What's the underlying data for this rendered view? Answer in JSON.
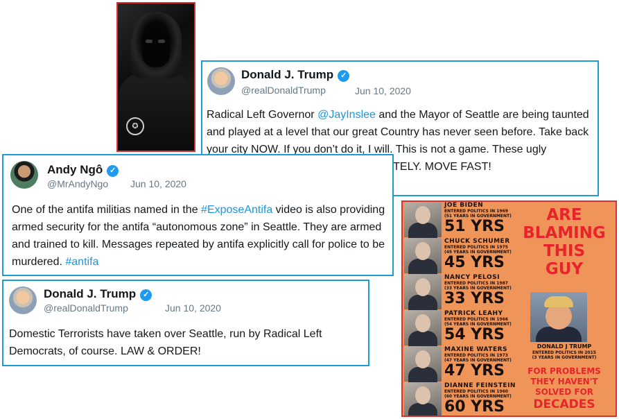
{
  "tweets": {
    "trump_1": {
      "name": "Donald J. Trump",
      "handle": "@realDonaldTrump",
      "date": "Jun 10, 2020",
      "text_before": "Radical Left Governor ",
      "mention": "@JayInslee",
      "text_after": " and the Mayor of Seattle are being taunted and played at a level that our great Country has never seen before. Take back your city NOW. If you don’t do it, I will. This is not a game. These ugly Anarchists must be stooped IMMEDIATELY. MOVE FAST!"
    },
    "ngo": {
      "name": "Andy Ngô",
      "handle": "@MrAndyNgo",
      "date": "Jun 10, 2020",
      "text_before": "One of the antifa militias named in the ",
      "hashtag1": "#ExposeAntifa",
      "text_middle": " video is also providing armed security for the antifa “autonomous zone” in Seattle. They are armed and trained to kill. Messages repeated by antifa explicitly call for police to be murdered. ",
      "hashtag2": "#antifa"
    },
    "trump_2": {
      "name": "Donald J. Trump",
      "handle": "@realDonaldTrump",
      "date": "Jun 10, 2020",
      "text": "Domestic Terrorists have taken over Seattle, run by Radical Left Democrats, of course. LAW & ORDER!"
    }
  },
  "meme": {
    "headline": [
      "ARE",
      "BLAMING",
      "THIS",
      "GUY"
    ],
    "politicians": [
      {
        "name": "JOE BIDEN",
        "detail1": "ENTERED POLITICS IN 1969",
        "detail2": "(51 YEARS IN GOVERNMENT)",
        "years": "51 YRS"
      },
      {
        "name": "CHUCK SCHUMER",
        "detail1": "ENTERED POLITICS IN 1975",
        "detail2": "(45 YEARS IN GOVERNMENT)",
        "years": "45 YRS"
      },
      {
        "name": "NANCY PELOSI",
        "detail1": "ENTERED POLITICS IN 1987",
        "detail2": "(33 YEARS IN GOVERNMENT)",
        "years": "33 YRS"
      },
      {
        "name": "PATRICK LEAHY",
        "detail1": "ENTERED POLITICS IN 1966",
        "detail2": "(54 YEARS IN GOVERNMENT)",
        "years": "54 YRS"
      },
      {
        "name": "MAXINE WATERS",
        "detail1": "ENTERED POLITICS IN 1973",
        "detail2": "(47 YEARS IN GOVERNMENT)",
        "years": "47 YRS"
      },
      {
        "name": "DIANNE FEINSTEIN",
        "detail1": "ENTERED POLITICS IN 1960",
        "detail2": "(60 YEARS IN GOVERNMENT)",
        "years": "60 YRS"
      }
    ],
    "trump": {
      "name": "DONALD J TRUMP",
      "detail1": "ENTERED POLITICS IN 2015",
      "detail2": "(3 YEARS IN GOVERNMENT)"
    },
    "bottom": [
      "FOR PROBLEMS",
      "THEY HAVEN'T",
      "SOLVED FOR",
      "DECADES"
    ]
  },
  "icons": {
    "verified": "verified-badge-icon",
    "photo": "hooded-figure-photo"
  },
  "colors": {
    "tweet_border": "#1d9bd7",
    "meme_border": "#d8322e",
    "meme_bg": "#f0955a",
    "link": "#1b95e0",
    "headline": "#e8242b"
  }
}
